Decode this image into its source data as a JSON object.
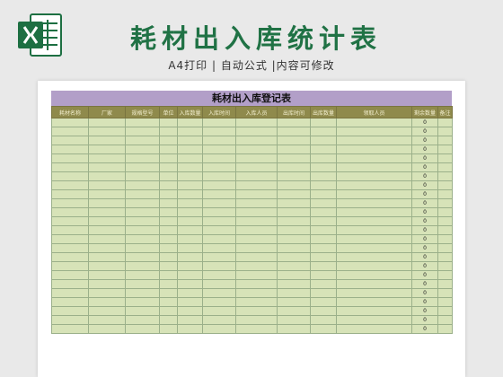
{
  "header": {
    "title": "耗材出入库统计表",
    "subtitle": "A4打印 | 自动公式 |内容可修改"
  },
  "sheet": {
    "title": "耗材出入库登记表",
    "columns": [
      "耗材名称",
      "厂家",
      "规格型号",
      "单位",
      "入库数量",
      "入库时间",
      "入库人员",
      "出库时间",
      "出库数量",
      "领取人员",
      "剩余数量",
      "备注"
    ],
    "row_count": 24,
    "remaining_default": "0"
  },
  "colors": {
    "title_green": "#207245",
    "title_bar": "#b29fc8",
    "header_bg": "#8f8a4c",
    "cell_bg": "#d7e3b8"
  },
  "icons": {
    "logo": "excel-logo-icon"
  }
}
